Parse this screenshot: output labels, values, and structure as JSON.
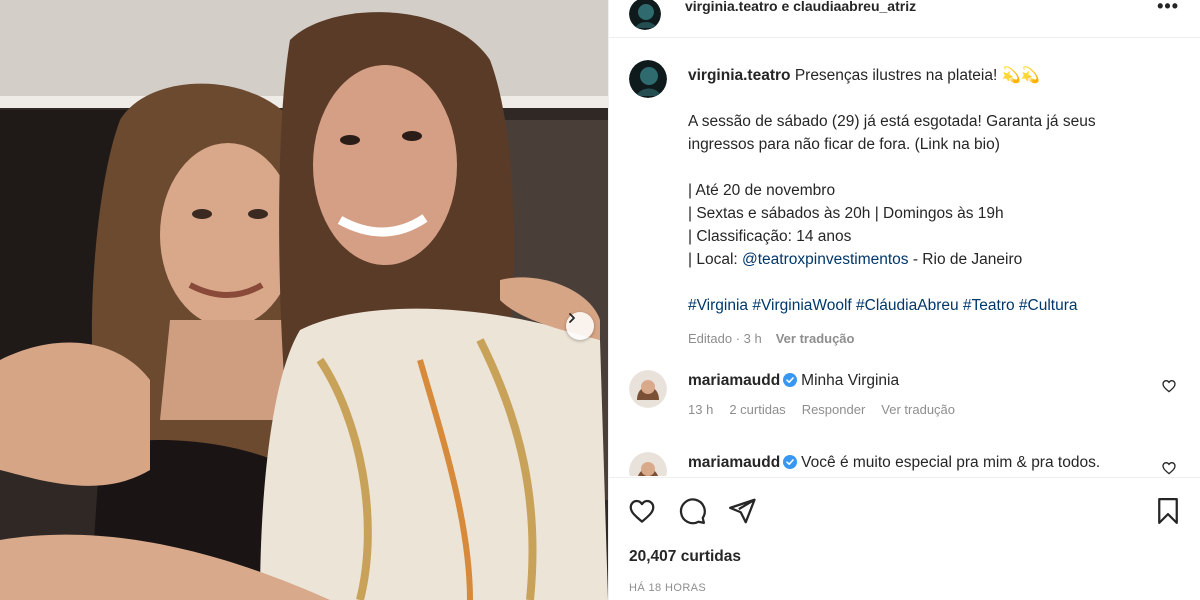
{
  "header": {
    "author_line": "virginia.teatro e claudiaabreu_atriz",
    "more_label": "•••"
  },
  "caption": {
    "username": "virginia.teatro",
    "lines": [
      "Presenças ilustres na plateia! 💫💫",
      "A sessão de sábado (29) já está esgotada! Garanta já seus",
      "ingressos para não ficar de fora. (Link na bio)",
      "| Até 20 de novembro",
      "| Sextas e sábados às 20h | Domingos às 19h",
      "| Classificação: 14 anos",
      "| Local:",
      "@teatroxpinvestimentos",
      "- Rio de Janeiro"
    ],
    "hashtags": [
      "#Virginia",
      "#VirginiaWoolf",
      "#CláudiaAbreu",
      "#Teatro",
      "#Cultura"
    ],
    "meta": {
      "edited": "Editado · 3 h",
      "translate": "Ver tradução"
    }
  },
  "comments": [
    {
      "username": "mariamaudd",
      "text": "Minha Virginia",
      "time": "13 h",
      "likes": "2 curtidas",
      "reply": "Responder",
      "translate": "Ver tradução"
    },
    {
      "username": "mariamaudd",
      "text": "Você é muito especial pra mim & pra todos."
    }
  ],
  "actions": {
    "likes_count": "20,407 curtidas",
    "timestamp": "HÁ 18 HORAS"
  },
  "icons": {
    "like": "heart-icon",
    "comment": "comment-icon",
    "share": "share-icon",
    "save": "bookmark-icon",
    "next": "chevron-right-icon",
    "verified": "verified-badge-icon"
  },
  "colors": {
    "link": "#00376b",
    "verified": "#3897f0",
    "muted": "#8e8e8e",
    "text": "#262626"
  }
}
